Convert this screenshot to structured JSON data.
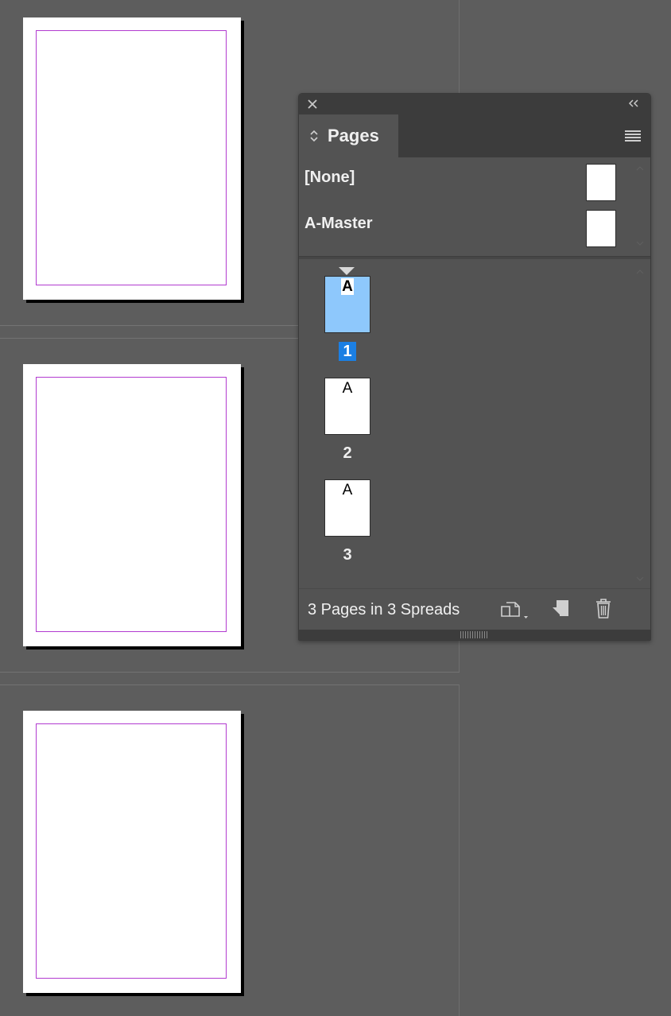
{
  "document": {
    "pages": [
      {
        "id": "doc-page-1"
      },
      {
        "id": "doc-page-2"
      },
      {
        "id": "doc-page-3"
      }
    ],
    "margin_color": "#b23bd0"
  },
  "panel": {
    "tab_label": "Pages",
    "icons": {
      "close": "close-icon",
      "collapse": "double-chevron-left-icon",
      "menu": "hamburger-menu-icon",
      "tab_arrows": "up-down-arrows-icon"
    },
    "masters": [
      {
        "label": "[None]"
      },
      {
        "label": "A-Master"
      }
    ],
    "pages": [
      {
        "master_letter": "A",
        "number": "1",
        "selected": true
      },
      {
        "master_letter": "A",
        "number": "2",
        "selected": false
      },
      {
        "master_letter": "A",
        "number": "3",
        "selected": false
      }
    ],
    "footer": {
      "status": "3 Pages in 3 Spreads",
      "buttons": [
        "edit-page-size-icon",
        "new-page-icon",
        "trash-icon"
      ]
    },
    "colors": {
      "selected_thumb": "#8ec8fc",
      "selected_number": "#1b7fe3"
    }
  }
}
